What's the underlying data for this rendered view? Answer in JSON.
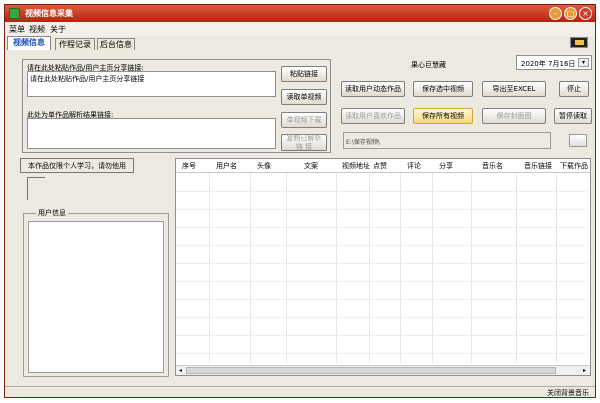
{
  "window": {
    "title": "视频信息采集"
  },
  "menu": [
    "菜单",
    "视频",
    "关于"
  ],
  "tabs": [
    {
      "label": "视频信息",
      "active": true
    },
    {
      "label": "作程记录",
      "active": false
    },
    {
      "label": "后台信息",
      "active": false
    }
  ],
  "link_panel": {
    "prompt": "请在此处粘贴作品/用户主页分享链接:",
    "link_value": "请在此处粘贴作品/用户主页分享链接",
    "result_label": "此处为单作品解析结果链接:",
    "buttons": {
      "paste": "粘贴链接",
      "read_single": "读取单视频",
      "download_single": "单视频下载",
      "copy_parse": "复制已解析\n链 接"
    }
  },
  "control_panel": {
    "title": "果心巨慧藏",
    "date": "2020年 7月16日",
    "buttons": {
      "read_user_feed": "读取用户动态作品",
      "save_selected": "保存选中视频",
      "export_excel": "导出至EXCEL",
      "stop": "停止",
      "read_user_likes": "读取用户喜欢作品",
      "save_all": "保存所有视频",
      "save_cover": "保存封面图",
      "pause": "暂停读取"
    },
    "save_path": "E:\\保存视频\\"
  },
  "notice": "本作品仅限个人学习，请勿他用",
  "user_info": {
    "label": "用户信息"
  },
  "table": {
    "columns": [
      "序号",
      "用户名",
      "头像",
      "文案",
      "视频地址",
      "点赞",
      "评论",
      "分享",
      "音乐名",
      "音乐链接",
      "下载作品"
    ]
  },
  "status": {
    "right_text": "关闭背景音乐"
  }
}
